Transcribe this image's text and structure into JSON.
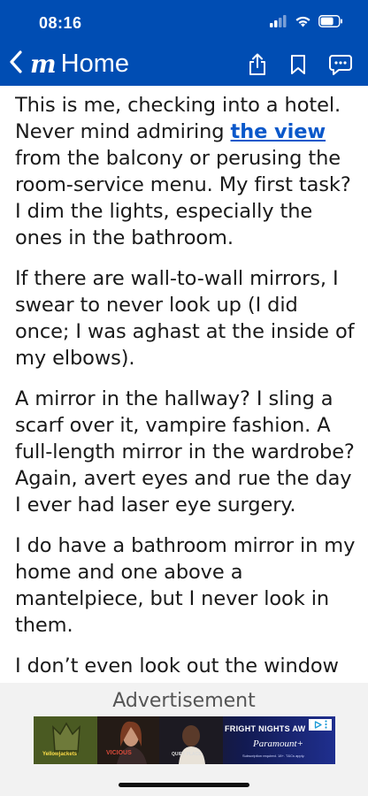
{
  "status_bar": {
    "time": "08:16"
  },
  "nav": {
    "back_label": "Home",
    "logo_text": "m"
  },
  "article": {
    "paragraphs": [
      {
        "before": "This is me, checking into a hotel. Never mind admiring ",
        "link": "the view",
        "after": " from the balcony or perusing the room-service menu. My first task? I dim the lights, especially the ones in the bathroom."
      },
      {
        "text": "If there are wall-to-wall mirrors, I swear to never look up (I did once; I was aghast at the inside of my elbows)."
      },
      {
        "text": "A mirror in the hallway? I sling a scarf over it, vampire fashion. A full-length mirror in the wardrobe? Again, avert eyes and rue the day I ever had laser eye surgery."
      },
      {
        "text": "I do have a bathroom mirror in my home and one above a mantelpiece, but I never look in them."
      },
      {
        "text": "I don’t even look out the window"
      }
    ]
  },
  "ad": {
    "label": "Advertisement",
    "headline": "FRIGHT NIGHTS AW",
    "brand": "Paramount+",
    "fine_print": "Subscription required. 18+. T&Cs apply.",
    "show_1": "Yellowjackets",
    "show_2": "VICIOUS",
    "show_3": "QUIET PLACE"
  },
  "colors": {
    "nav_bg": "#004db3",
    "link": "#0a58ca",
    "ad_bg": "#f2f2f2"
  }
}
